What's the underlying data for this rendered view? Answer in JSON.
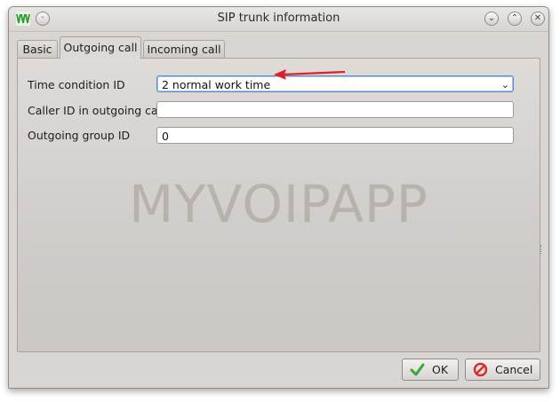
{
  "window": {
    "title": "SIP trunk information"
  },
  "tabs": [
    {
      "label": "Basic"
    },
    {
      "label": "Outgoing call"
    },
    {
      "label": "Incoming call"
    }
  ],
  "form": {
    "time_condition": {
      "label": "Time condition ID",
      "value": "2 normal work time"
    },
    "caller_id": {
      "label": "Caller ID in outgoing call",
      "value": ""
    },
    "outgoing_group": {
      "label": "Outgoing group ID",
      "value": "0"
    }
  },
  "watermark": "MYVOIPAPP",
  "buttons": {
    "ok": "OK",
    "cancel": "Cancel"
  },
  "colors": {
    "accent": "#5b8ac9",
    "ok_icon": "#3aa835",
    "cancel_icon": "#d62d2d",
    "arrow": "#e02020",
    "app_icon": "#2e9b2e"
  },
  "icons": {
    "app": "voip-logo-icon",
    "minimize": "chevron-down-icon",
    "maximize": "chevron-up-icon",
    "close": "close-icon"
  }
}
